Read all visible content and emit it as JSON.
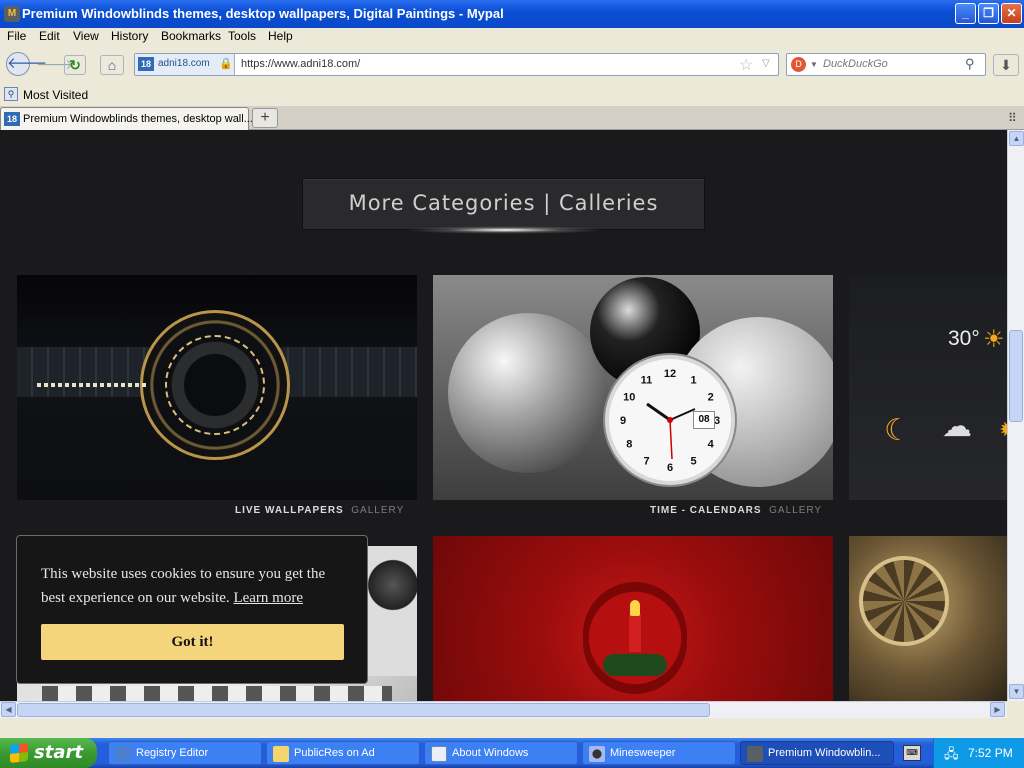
{
  "window": {
    "title": "Premium Windowblinds themes, desktop wallpapers, Digital Paintings - Mypal"
  },
  "menu": [
    "File",
    "Edit",
    "View",
    "History",
    "Bookmarks",
    "Tools",
    "Help"
  ],
  "navbar": {
    "site_id": "adni18.com",
    "url": "https://www.adni18.com/",
    "search_placeholder": "DuckDuckGo"
  },
  "bookmarks": {
    "most_visited": "Most Visited"
  },
  "tabs": [
    {
      "label": "Premium Windowblinds themes, desktop wall..."
    }
  ],
  "page": {
    "category_heading": "More Categories | Calleries",
    "tiles": [
      {
        "title": "LIVE WALLPAPERS",
        "suffix": "GALLERY"
      },
      {
        "title": "TIME - CALENDARS",
        "suffix": "GALLERY"
      }
    ],
    "clock": {
      "numbers": [
        "12",
        "1",
        "2",
        "3",
        "4",
        "5",
        "6",
        "7",
        "8",
        "9",
        "10",
        "11"
      ],
      "date": "08"
    },
    "weather_temp": "30°"
  },
  "cookie": {
    "text": "This website uses cookies to ensure you get the best experience on our website.",
    "link": "Learn more",
    "button": "Got it!"
  },
  "taskbar": {
    "start": "start",
    "items": [
      {
        "label": "Registry Editor",
        "icon": "registry-icon"
      },
      {
        "label": "PublicRes on Ad",
        "icon": "folder-icon"
      },
      {
        "label": "About Windows",
        "icon": "window-icon"
      },
      {
        "label": "Minesweeper",
        "icon": "mine-icon"
      },
      {
        "label": "Premium Windowblin...",
        "icon": "browser-icon"
      }
    ],
    "clock": "7:52 PM"
  },
  "colors": {
    "title_bar": "#0a4fd6",
    "page_background": "#1a1a1c",
    "cookie_button": "#f5d57c",
    "taskbar": "#245edb",
    "start_button": "#3a9a31"
  }
}
